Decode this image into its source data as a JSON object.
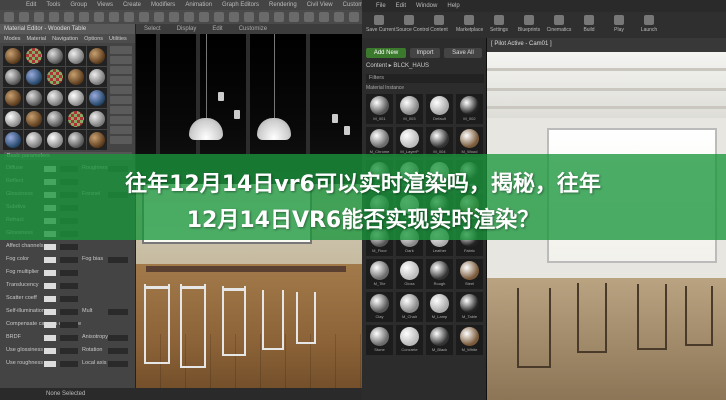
{
  "max": {
    "menu": [
      "Edit",
      "Tools",
      "Group",
      "Views",
      "Create",
      "Modifiers",
      "Animation",
      "Graph Editors",
      "Rendering",
      "Civil View",
      "Customize",
      "Scripting",
      "Help"
    ],
    "tabs": [
      "Select",
      "Display",
      "Edit",
      "Customize"
    ],
    "material_editor": {
      "title": "Material Editor - Wooden Table",
      "menu": [
        "Modes",
        "Material",
        "Navigation",
        "Options",
        "Utilities"
      ],
      "params": [
        {
          "label": "Basic parameters",
          "section": true
        },
        {
          "label": "Diffuse",
          "label2": "Roughness"
        },
        {
          "label": "Reflect",
          "label2": ""
        },
        {
          "label": "Glossiness",
          "label2": "Fresnel"
        },
        {
          "label": "Subdivs",
          "label2": ""
        },
        {
          "label": "Refract",
          "label2": ""
        },
        {
          "label": "Glossiness",
          "label2": ""
        },
        {
          "label": "Affect channels",
          "label2": ""
        },
        {
          "label": "Fog color",
          "label2": "Fog bias"
        },
        {
          "label": "Fog multiplier",
          "label2": ""
        },
        {
          "label": "Translucency",
          "label2": ""
        },
        {
          "label": "Scatter coeff",
          "label2": ""
        },
        {
          "label": "Self-illumination",
          "label2": "Mult"
        },
        {
          "label": "Compensate camera exposure",
          "label2": ""
        },
        {
          "label": "BRDF",
          "label2": "Anisotropy"
        },
        {
          "label": "Use glossiness",
          "label2": "Rotation"
        },
        {
          "label": "Use roughness",
          "label2": "Local axis"
        }
      ]
    },
    "status": "None Selected"
  },
  "ue": {
    "menu": [
      "File",
      "Edit",
      "Window",
      "Help"
    ],
    "toolbar": [
      "Save Current",
      "Source Control",
      "Content",
      "Marketplace",
      "Settings",
      "Blueprints",
      "Cinematics",
      "Build",
      "Play",
      "Launch"
    ],
    "add_new": "Add New",
    "import": "Import",
    "save_all": "Save All",
    "path": "Content ▸ BLCK_HAUS",
    "filters": "Filters",
    "section_label": "Material Instance",
    "assets": [
      "M_001",
      "M_003",
      "Default",
      "M_002",
      "M_Chrome",
      "M_LayerP",
      "M_004",
      "M_Wood",
      "Cloth",
      "Ceramic",
      "M_Wall",
      "Plastic",
      "Matte",
      "Metal",
      "Glass",
      "M_Base",
      "M_Floor",
      "Dark",
      "Leather",
      "Fabric",
      "M_Tile",
      "Gloss",
      "Rough",
      "Steel",
      "Clay",
      "M_Chair",
      "M_Lamp",
      "M_Table",
      "Stone",
      "Concrete",
      "M_Black",
      "M_White"
    ],
    "viewport_tab": "[ Pilot Active - Cam01 ]"
  },
  "headline": {
    "line1": "往年12月14日vr6可以实时渲染吗，揭秘，往年",
    "line2": "12月14日VR6能否实现实时渲染？"
  },
  "colors": {
    "banner": "#1a963c",
    "ue_addnew": "#3b7a2c"
  }
}
